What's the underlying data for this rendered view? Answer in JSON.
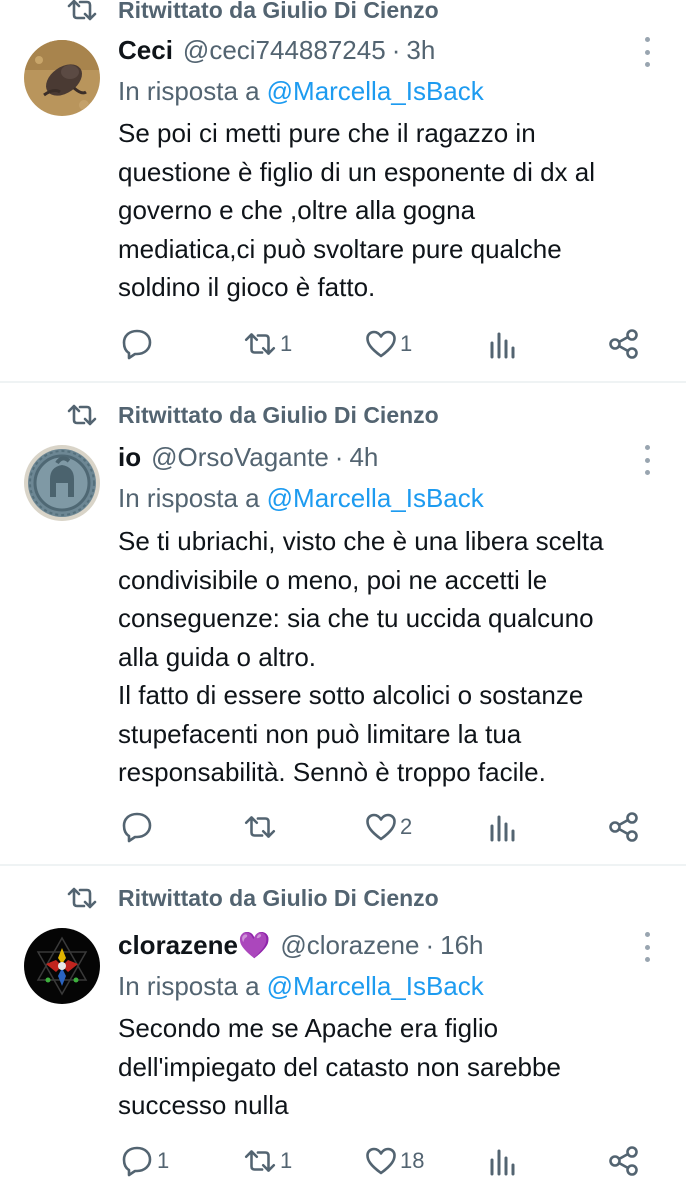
{
  "tweets": [
    {
      "retweeted_by": "Ritwittato da Giulio Di Cienzo",
      "name": "Ceci",
      "handle": "@ceci744887245",
      "separator": "·",
      "time": "3h",
      "reply_prefix": "In risposta a",
      "reply_to": "@Marcella_IsBack",
      "text": "Se poi ci metti pure che il ragazzo in\nquestione è figlio di un esponente di dx al\ngoverno e che ,oltre alla gogna\nmediatica,ci può svoltare pure qualche\nsoldino il gioco è fatto.",
      "replies": "",
      "retweets": "1",
      "likes": "1"
    },
    {
      "retweeted_by": "Ritwittato da Giulio Di Cienzo",
      "name": "io",
      "handle": "@OrsoVagante",
      "separator": "·",
      "time": "4h",
      "reply_prefix": "In risposta a",
      "reply_to": "@Marcella_IsBack",
      "text": "Se ti ubriachi, visto che è una libera scelta\ncondivisibile o meno, poi ne accetti le\nconseguenze: sia che tu uccida qualcuno\nalla guida o altro.\nIl fatto di essere sotto alcolici o sostanze\nstupefacenti non può limitare la tua\nresponsabilità. Sennò è troppo facile.",
      "replies": "",
      "retweets": "",
      "likes": "2"
    },
    {
      "retweeted_by": "Ritwittato da Giulio Di Cienzo",
      "name": "clorazene💜",
      "handle": "@clorazene",
      "separator": "·",
      "time": "16h",
      "reply_prefix": "In risposta a",
      "reply_to": "@Marcella_IsBack",
      "text": "Secondo me se Apache era figlio\ndell'impiegato del catasto non sarebbe\nsuccesso nulla",
      "replies": "1",
      "retweets": "1",
      "likes": "18"
    }
  ],
  "icons": {
    "retweet": "retweet-icon",
    "reply": "reply-icon",
    "like": "heart-icon",
    "views": "views-icon",
    "share": "share-icon",
    "more": "more-icon"
  },
  "colors": {
    "text": "#0f1419",
    "secondary": "#536471",
    "mention": "#1d9bf0",
    "divider": "#eff3f4"
  }
}
